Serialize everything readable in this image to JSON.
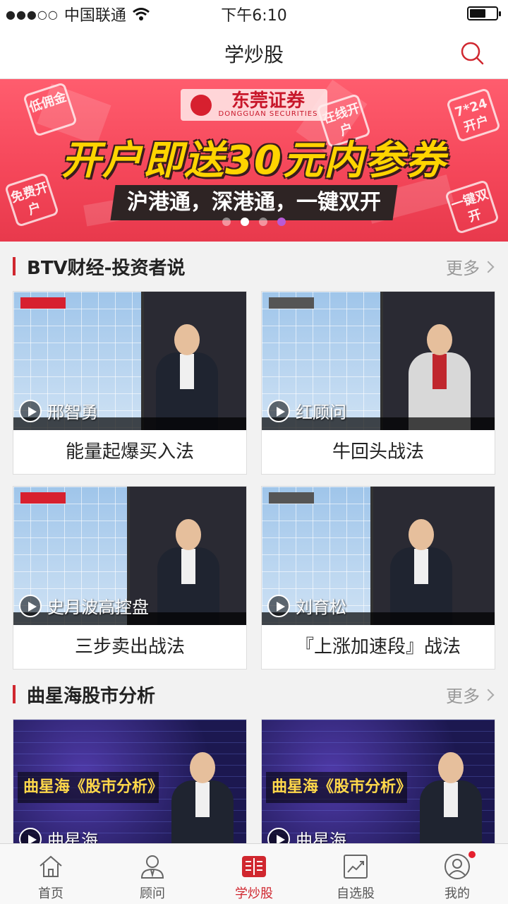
{
  "status_bar": {
    "signal": "●●●○○",
    "carrier": "中国联通",
    "time": "下午6:10"
  },
  "nav": {
    "title": "学炒股"
  },
  "banner": {
    "brand_cn": "东莞证券",
    "brand_en": "DONGGUAN SECURITIES",
    "headline": "开户即送30元内参券",
    "subline": "沪港通，深港通，一键双开",
    "badges": [
      "低佣金",
      "在线开户",
      "7*24开户",
      "免费开户",
      "一键双开"
    ],
    "page_count": 4,
    "active_page": 2
  },
  "sections": [
    {
      "title": "BTV财经-投资者说",
      "more": "更多",
      "videos": [
        {
          "presenter": "邢智勇",
          "title": "能量起爆买入法"
        },
        {
          "presenter": "红顾问",
          "title": "牛回头战法"
        },
        {
          "presenter": "史月波高控盘",
          "title": "三步卖出战法"
        },
        {
          "presenter": "刘育松",
          "title": "『上涨加速段』战法"
        }
      ]
    },
    {
      "title": "曲星海股市分析",
      "more": "更多",
      "videos": [
        {
          "presenter": "曲星海",
          "overlay": "曲星海《股市分析》"
        },
        {
          "presenter": "曲星海",
          "overlay": "曲星海《股市分析》"
        }
      ]
    }
  ],
  "tabbar": {
    "items": [
      {
        "label": "首页",
        "icon": "home-icon"
      },
      {
        "label": "顾问",
        "icon": "advisor-icon"
      },
      {
        "label": "学炒股",
        "icon": "book-icon",
        "active": true
      },
      {
        "label": "自选股",
        "icon": "chart-icon"
      },
      {
        "label": "我的",
        "icon": "profile-icon",
        "badge": true
      }
    ]
  },
  "colors": {
    "accent": "#d0272f",
    "banner": "#f5475a"
  }
}
